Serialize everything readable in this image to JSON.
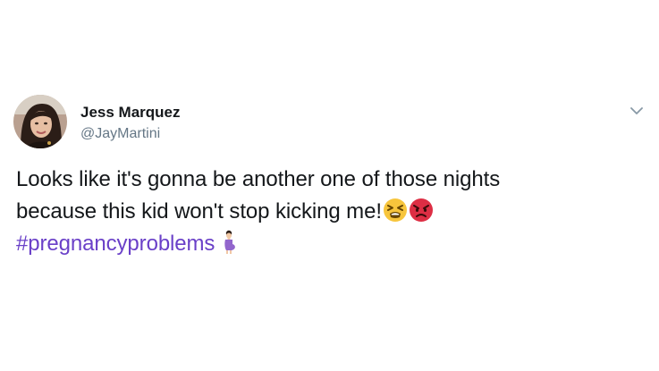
{
  "tweet": {
    "author": {
      "display_name": "Jess Marquez",
      "handle": "@JayMartini",
      "avatar_icon": "profile-photo"
    },
    "menu_icon": "chevron-down-icon",
    "text": {
      "line1": "Looks like it's gonna be another one of those nights",
      "line2": "because this kid won't stop kicking me!",
      "hashtag": "#pregnancyproblems"
    },
    "emojis": [
      "tired-face-emoji",
      "angry-face-emoji",
      "pregnant-woman-emoji"
    ]
  },
  "colors": {
    "text": "#14171a",
    "secondary": "#657786",
    "hashtag": "#6a40c8"
  }
}
